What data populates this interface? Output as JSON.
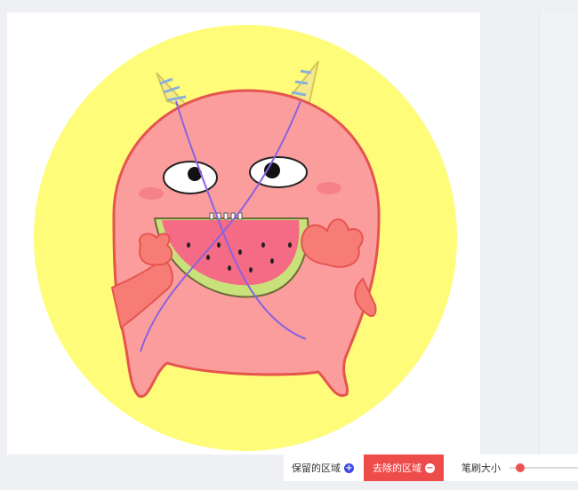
{
  "image": {
    "subject": "cute-monster-eating-watermelon",
    "colors": {
      "background_circle": "#fefc78",
      "body": "#fc9d9d",
      "outline": "#e5554f",
      "watermelon": "#f56b85",
      "rind": "#c9e17a",
      "stroke_marks": "#8a63e0"
    }
  },
  "toolbar": {
    "keep_label": "保留的区域",
    "keep_icon": "plus-circle-icon",
    "remove_label": "去除的区域",
    "remove_icon": "minus-circle-icon",
    "brush_label": "笔刷大小",
    "brush_size_fraction": 0.1
  }
}
